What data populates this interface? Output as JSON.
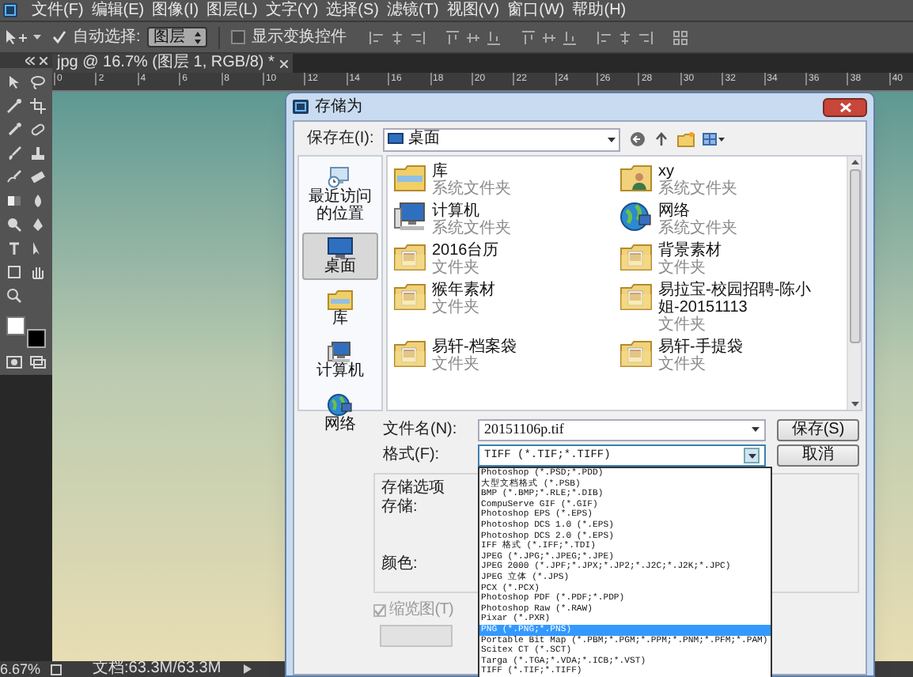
{
  "menu_bar": [
    "文件(F)",
    "编辑(E)",
    "图像(I)",
    "图层(L)",
    "文字(Y)",
    "选择(S)",
    "滤镜(T)",
    "视图(V)",
    "窗口(W)",
    "帮助(H)"
  ],
  "options_bar": {
    "auto_select": {
      "label": "自动选择:",
      "checked": true
    },
    "auto_select_target": "图层",
    "show_transform": {
      "label": "显示变换控件",
      "checked": false
    }
  },
  "document_tab": {
    "title": "jpg @ 16.7% (图层 1, RGB/8) *"
  },
  "ruler": [
    "0",
    "2",
    "4",
    "6",
    "8",
    "10",
    "12",
    "14",
    "16",
    "18",
    "20",
    "22",
    "24",
    "26",
    "28",
    "30",
    "32",
    "34",
    "36",
    "38",
    "40"
  ],
  "status_bar": {
    "zoom": "6.67%",
    "document": "文档:63.3M/63.3M"
  },
  "dialog": {
    "title": "存储为",
    "save_in_label": "保存在(I):",
    "save_in": "桌面",
    "places": [
      {
        "kind": "recent",
        "label": "最近访问的位置",
        "selected": false
      },
      {
        "kind": "desktop",
        "label": "桌面",
        "selected": true
      },
      {
        "kind": "library",
        "label": "库",
        "selected": false
      },
      {
        "kind": "computer",
        "label": "计算机",
        "selected": false
      },
      {
        "kind": "network",
        "label": "网络",
        "selected": false
      }
    ],
    "files": [
      {
        "kind": "library",
        "name": "库",
        "type": "系统文件夹"
      },
      {
        "kind": "user",
        "name": "xy",
        "type": "系统文件夹"
      },
      {
        "kind": "computer",
        "name": "计算机",
        "type": "系统文件夹"
      },
      {
        "kind": "network",
        "name": "网络",
        "type": "系统文件夹"
      },
      {
        "kind": "folder",
        "name": "2016台历",
        "type": "文件夹"
      },
      {
        "kind": "folder",
        "name": "背景素材",
        "type": "文件夹"
      },
      {
        "kind": "folder",
        "name": "猴年素材",
        "type": "文件夹"
      },
      {
        "kind": "folder",
        "name": "易拉宝-校园招聘-陈小姐-20151113",
        "type": "文件夹"
      },
      {
        "kind": "folder",
        "name": "易轩-档案袋",
        "type": "文件夹"
      },
      {
        "kind": "folder",
        "name": "易轩-手提袋",
        "type": "文件夹"
      }
    ],
    "file_name_label": "文件名(N):",
    "file_name": "20151106p.tif",
    "format_label": "格式(F):",
    "format": "TIFF (*.TIF;*.TIFF)",
    "format_options": [
      {
        "label": "Photoshop (*.PSD;*.PDD)",
        "selected": false
      },
      {
        "label": "大型文档格式 (*.PSB)",
        "selected": false
      },
      {
        "label": "BMP (*.BMP;*.RLE;*.DIB)",
        "selected": false
      },
      {
        "label": "CompuServe GIF (*.GIF)",
        "selected": false
      },
      {
        "label": "Photoshop EPS (*.EPS)",
        "selected": false
      },
      {
        "label": "Photoshop DCS 1.0 (*.EPS)",
        "selected": false
      },
      {
        "label": "Photoshop DCS 2.0 (*.EPS)",
        "selected": false
      },
      {
        "label": "IFF 格式 (*.IFF;*.TDI)",
        "selected": false
      },
      {
        "label": "JPEG (*.JPG;*.JPEG;*.JPE)",
        "selected": false
      },
      {
        "label": "JPEG 2000 (*.JPF;*.JPX;*.JP2;*.J2C;*.J2K;*.JPC)",
        "selected": false
      },
      {
        "label": "JPEG 立体 (*.JPS)",
        "selected": false
      },
      {
        "label": "PCX (*.PCX)",
        "selected": false
      },
      {
        "label": "Photoshop PDF (*.PDF;*.PDP)",
        "selected": false
      },
      {
        "label": "Photoshop Raw (*.RAW)",
        "selected": false
      },
      {
        "label": "Pixar (*.PXR)",
        "selected": false
      },
      {
        "label": "PNG (*.PNG;*.PNS)",
        "selected": true
      },
      {
        "label": "Portable Bit Map (*.PBM;*.PGM;*.PPM;*.PNM;*.PFM;*.PAM)",
        "selected": false
      },
      {
        "label": "Scitex CT (*.SCT)",
        "selected": false
      },
      {
        "label": "Targa (*.TGA;*.VDA;*.ICB;*.VST)",
        "selected": false
      },
      {
        "label": "TIFF (*.TIF;*.TIFF)",
        "selected": false
      }
    ],
    "buttons": [
      "保存(S)",
      "取消"
    ],
    "save_options_label": "存储选项",
    "save_label": "存储:",
    "color_label": "颜色:",
    "thumbnail": {
      "label": "缩览图(T)",
      "checked": true,
      "disabled": true
    }
  }
}
